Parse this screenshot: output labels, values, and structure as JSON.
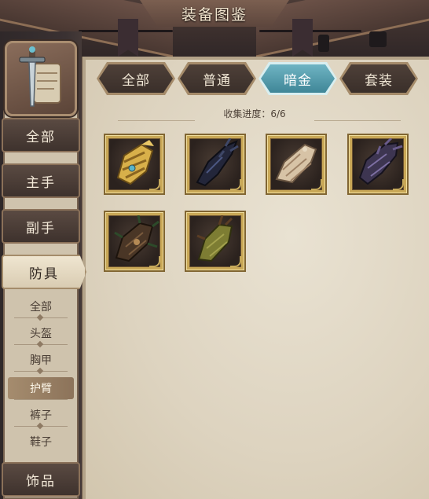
{
  "header": {
    "title": "装备图鉴"
  },
  "tabs": [
    {
      "label": "全部",
      "active": false
    },
    {
      "label": "普通",
      "active": false
    },
    {
      "label": "暗金",
      "active": true
    },
    {
      "label": "套装",
      "active": false
    }
  ],
  "progress": {
    "text": "收集进度：6/6"
  },
  "sidebar": {
    "portrait_icon": "sword-scroll-icon",
    "categories": [
      {
        "label": "全部",
        "active": false
      },
      {
        "label": "主手",
        "active": false
      },
      {
        "label": "副手",
        "active": false
      },
      {
        "label": "防具",
        "active": true
      },
      {
        "label": "饰品",
        "active": false
      }
    ],
    "subcategories": [
      {
        "label": "全部",
        "active": false
      },
      {
        "label": "头盔",
        "active": false
      },
      {
        "label": "胸甲",
        "active": false
      },
      {
        "label": "护臂",
        "active": true
      },
      {
        "label": "裤子",
        "active": false
      },
      {
        "label": "鞋子",
        "active": false
      }
    ]
  },
  "items": [
    {
      "icon": "golden-bracer-icon",
      "color": "#d8b04a"
    },
    {
      "icon": "black-spiked-bracer-icon",
      "color": "#23263a"
    },
    {
      "icon": "bandaged-bracer-icon",
      "color": "#d7c3a6"
    },
    {
      "icon": "purple-dark-bracer-icon",
      "color": "#3d3551"
    },
    {
      "icon": "leather-spiked-bracer-icon",
      "color": "#4a3626"
    },
    {
      "icon": "olive-bracer-icon",
      "color": "#7d7d33"
    }
  ],
  "colors": {
    "active_tab": "#4f98a9",
    "frame": "#ddd3bf",
    "gold_border": "#c9a857"
  }
}
